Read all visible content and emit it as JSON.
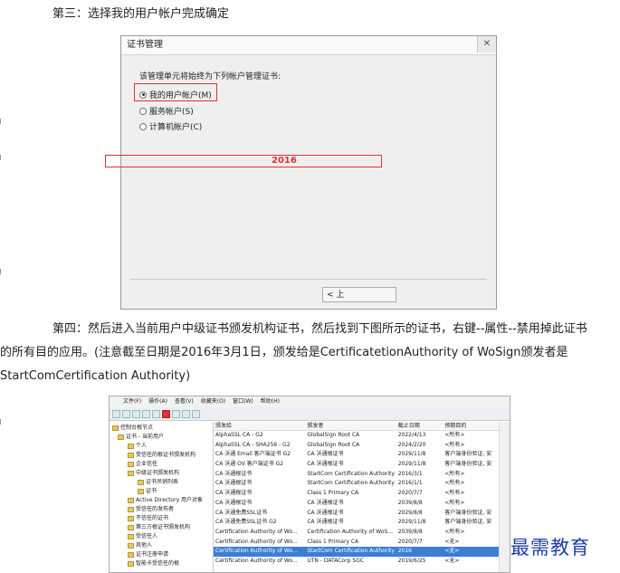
{
  "step3": "第三：选择我的用户帐户完成确定",
  "dialog": {
    "title": "证书管理",
    "close": "✕",
    "prompt": "该管理单元将始终为下列帐户管理证书:",
    "options": [
      "我的用户帐户(M)",
      "服务帐户(S)",
      "计算机帐户(C)"
    ],
    "selected": 0,
    "back_button": "< 上"
  },
  "step4_line1": "第四：然后进入当前用户中级证书颁发机构证书，然后找到下图所示的证书，右键--属性--禁用掉此证书",
  "step4_rest": "的所有目的应用。(注意截至日期是2016年3月1日，颁发给是CertificatetionAuthority  of WoSign颁发者是StartComCertification Authority)",
  "mmc": {
    "menu": [
      "文件(F)",
      "操作(A)",
      "查看(V)",
      "收藏夹(O)",
      "窗口(W)",
      "帮助(H)"
    ],
    "tree": [
      "控制台根节点",
      "证书 - 当前用户",
      "个人",
      "受信任的根证书颁发机构",
      "企业信任",
      "中级证书颁发机构",
      "证书吊销列表",
      "证书",
      "Active Directory 用户对象",
      "受信任的发布者",
      "不信任的证书",
      "第三方根证书颁发机构",
      "受信任人",
      "其他人",
      "证书注册申请",
      "智能卡受信任的根"
    ],
    "columns": [
      "颁发给",
      "颁发者",
      "截止日期",
      "预期目的"
    ],
    "rows": [
      [
        "AlphaSSL CA - G2",
        "GlobalSign Root CA",
        "2022/4/13",
        "<所有>"
      ],
      [
        "AlphaSSL CA - SHA256 - G2",
        "GlobalSign Root CA",
        "2024/2/20",
        "<所有>"
      ],
      [
        "CA 沃通 Email 客户端证书 G2",
        "CA 沃通根证书",
        "2029/11/8",
        "客户端身份验证, 安"
      ],
      [
        "CA 沃通 OV 客户端证书 G2",
        "CA 沃通根证书",
        "2029/11/8",
        "客户端身份验证, 安"
      ],
      [
        "CA 沃通根证书",
        "StartCom Certification Authority",
        "2016/3/1",
        "<所有>"
      ],
      [
        "CA 沃通根证书",
        "StartCom Certification Authority",
        "2016/1/1",
        "<所有>"
      ],
      [
        "CA 沃通根证书",
        "Class 1 Primary CA",
        "2020/7/7",
        "<所有>"
      ],
      [
        "CA 沃通根证书",
        "CA 沃通根证书",
        "2039/8/8",
        "<所有>"
      ],
      [
        "CA 沃通免费SSL证书",
        "CA 沃通根证书",
        "2029/8/8",
        "客户端身份验证, 安"
      ],
      [
        "CA 沃通免费SSL证书 G2",
        "CA 沃通根证书",
        "2029/11/8",
        "客户端身份验证, 安"
      ],
      [
        "Certification Authority of Wo...",
        "Certification Authority of WoS...",
        "2039/8/8",
        "<所有>"
      ],
      [
        "Certification Authority of Wo...",
        "Class 1 Primary CA",
        "2020/7/7",
        "<无>"
      ],
      [
        "Certification Authority of Wo...",
        "StartCom Certification Authority",
        "2016",
        "<无>"
      ],
      [
        "Certification Authority of Wo...",
        "UTN - DATACorp SGC",
        "2019/6/25",
        "<无>"
      ]
    ],
    "selected_row": 12,
    "highlight_year": "2016"
  },
  "watermark": "最需教育"
}
